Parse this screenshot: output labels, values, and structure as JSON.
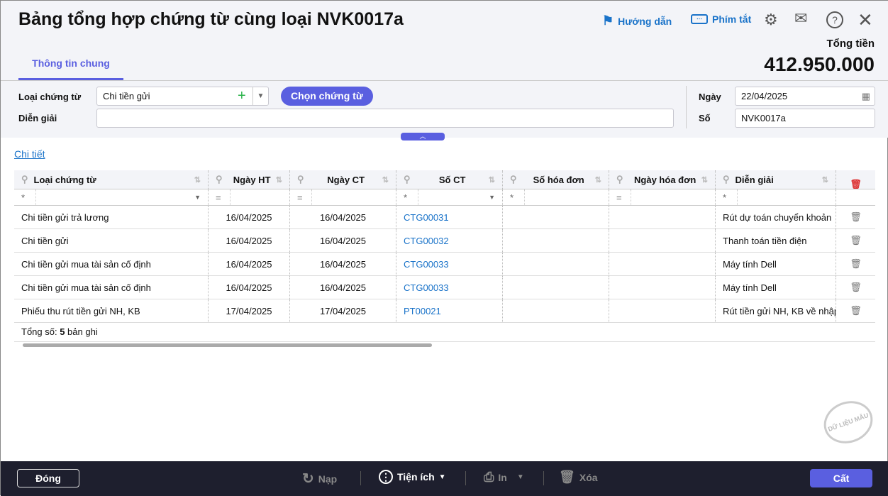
{
  "title": "Bảng tổng hợp chứng từ cùng loại NVK0017a",
  "toolbar": {
    "guide": "Hướng dẫn",
    "shortcut": "Phím tắt"
  },
  "total": {
    "label": "Tổng tiền",
    "value": "412.950.000"
  },
  "tab": "Thông tin chung",
  "form": {
    "type_label": "Loại chứng từ",
    "type_value": "Chi tiền gửi",
    "choose_button": "Chọn chứng từ",
    "desc_label": "Diễn giải",
    "desc_value": "",
    "date_label": "Ngày",
    "date_value": "22/04/2025",
    "no_label": "Số",
    "no_value": "NVK0017a"
  },
  "detail_link": "Chi tiết",
  "columns": [
    "Loại chứng từ",
    "Ngày HT",
    "Ngày CT",
    "Số CT",
    "Số hóa đơn",
    "Ngày hóa đơn",
    "Diễn giải"
  ],
  "filters": [
    "*",
    "=",
    "=",
    "*",
    "*",
    "=",
    "*"
  ],
  "rows": [
    [
      "Chi tiền gửi trả lương",
      "16/04/2025",
      "16/04/2025",
      "CTG00031",
      "",
      "",
      "Rút dự toán chuyển khoản"
    ],
    [
      "Chi tiền gửi",
      "16/04/2025",
      "16/04/2025",
      "CTG00032",
      "",
      "",
      "Thanh toán tiền điện"
    ],
    [
      "Chi tiền gửi mua tài sản cố định",
      "16/04/2025",
      "16/04/2025",
      "CTG00033",
      "",
      "",
      "Máy tính Dell"
    ],
    [
      "Chi tiền gửi mua tài sản cố định",
      "16/04/2025",
      "16/04/2025",
      "CTG00033",
      "",
      "",
      "Máy tính Dell"
    ],
    [
      "Phiếu thu rút tiền gửi NH, KB",
      "17/04/2025",
      "17/04/2025",
      "PT00021",
      "",
      "",
      "Rút tiền gửi NH, KB về nhập quỹ"
    ]
  ],
  "summary": {
    "prefix": "Tổng số: ",
    "count": "5",
    "suffix": " bản ghi"
  },
  "watermark": "DỮ LIỆU MẪU",
  "footer": {
    "close": "Đóng",
    "reload": "Nạp",
    "utilities": "Tiện ích",
    "print": "In",
    "delete": "Xóa",
    "save": "Cất"
  }
}
